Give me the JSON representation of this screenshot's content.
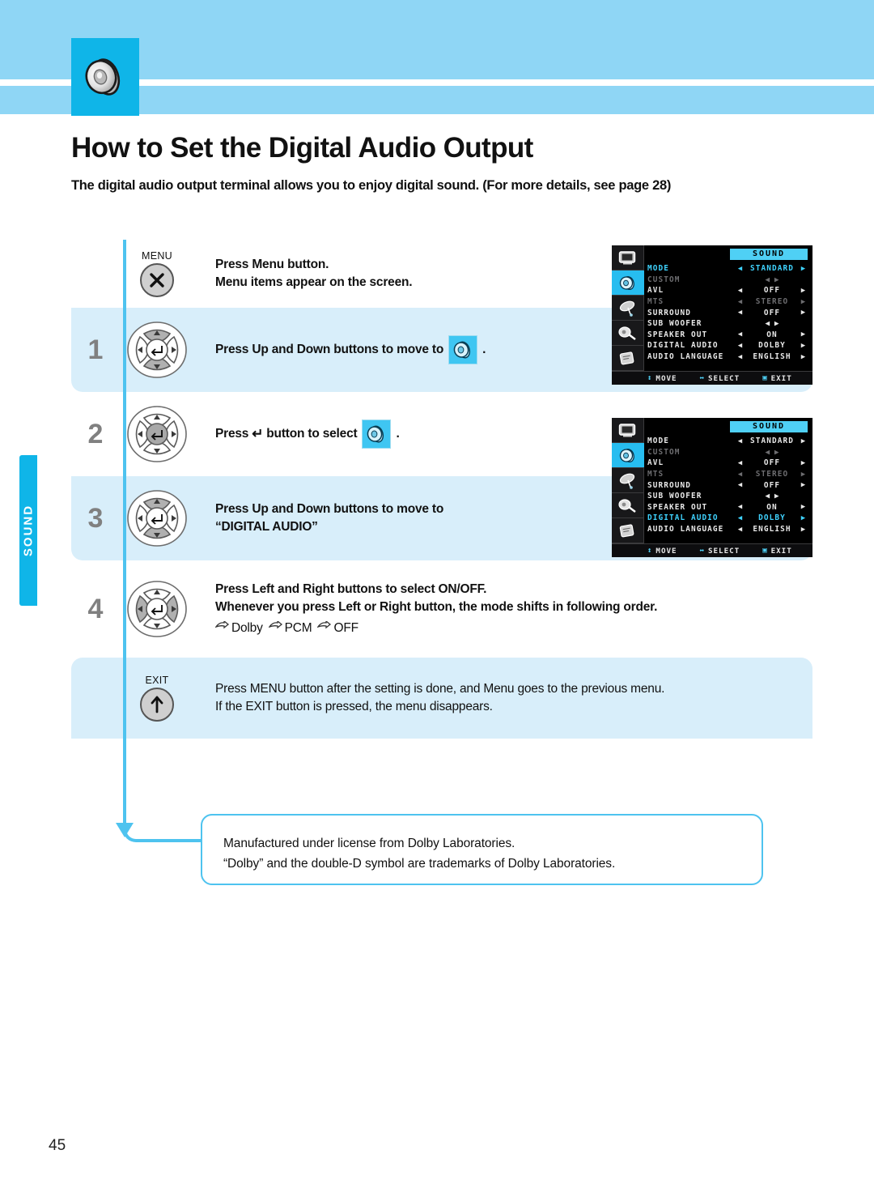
{
  "header": {
    "icon": "speaker-icon",
    "accent_color": "#0fb5e8",
    "band_color": "#8fd6f5"
  },
  "side_tab": {
    "label": "SOUND"
  },
  "title": "How to Set the Digital Audio Output",
  "subtitle": "The digital audio output terminal allows you to enjoy digital sound. (For more details, see page 28)",
  "steps": [
    {
      "number": "",
      "button": "menu-button",
      "button_label": "MENU",
      "lines": [
        "Press Menu button.",
        "Menu items appear on the screen."
      ],
      "tinted": false
    },
    {
      "number": "1",
      "button": "dpad-updown",
      "lines": [
        "Press Up and Down buttons to move to"
      ],
      "trailing": ".",
      "badge": "speaker-icon",
      "tinted": true
    },
    {
      "number": "2",
      "button": "dpad-enter",
      "lines": [
        "Press"
      ],
      "mid": "button to select",
      "trailing": ".",
      "badge": "speaker-icon",
      "enter_glyph": "↵",
      "tinted": false
    },
    {
      "number": "3",
      "button": "dpad-updown",
      "lines": [
        "Press Up and Down buttons to move to",
        "“DIGITAL AUDIO”"
      ],
      "tinted": true
    },
    {
      "number": "4",
      "button": "dpad-leftright",
      "lines": [
        "Press Left and Right buttons to select ON/OFF.",
        "Whenever you press Left or Right button, the mode shifts in following order."
      ],
      "order": [
        "Dolby",
        "PCM",
        "OFF"
      ],
      "tinted": false
    },
    {
      "number": "",
      "button": "exit-button",
      "button_label": "EXIT",
      "lines": [
        "Press MENU button after the setting is done, and Menu goes to the previous menu.",
        "If the EXIT button is pressed, the menu disappears."
      ],
      "light": true,
      "tinted": true
    }
  ],
  "osd": {
    "title": "SOUND",
    "side_icons": [
      "picture-icon",
      "speaker-icon",
      "satellite-icon",
      "tools-icon",
      "setup-icon"
    ],
    "selected_side_icon": 1,
    "status_bar": [
      {
        "glyph": "↕",
        "label": "MOVE"
      },
      {
        "glyph": "↔",
        "label": "SELECT"
      },
      {
        "glyph": "▣",
        "label": "EXIT"
      }
    ],
    "menu_1": {
      "rows": [
        {
          "label": "MODE",
          "value": "STANDARD",
          "state": "highlight",
          "arrows": "both"
        },
        {
          "label": "CUSTOM",
          "value": "",
          "state": "dim",
          "arrows": "pair"
        },
        {
          "label": "AVL",
          "value": "OFF",
          "state": "normal",
          "arrows": "both"
        },
        {
          "label": "MTS",
          "value": "STEREO",
          "state": "dim",
          "arrows": "both"
        },
        {
          "label": "SURROUND",
          "value": "OFF",
          "state": "normal",
          "arrows": "both"
        },
        {
          "label": "SUB WOOFER",
          "value": "",
          "state": "normal",
          "arrows": "pair"
        },
        {
          "label": "SPEAKER OUT",
          "value": "ON",
          "state": "normal",
          "arrows": "both"
        },
        {
          "label": "DIGITAL AUDIO",
          "value": "DOLBY",
          "state": "normal",
          "arrows": "both"
        },
        {
          "label": "AUDIO LANGUAGE",
          "value": "ENGLISH",
          "state": "normal",
          "arrows": "both"
        }
      ]
    },
    "menu_2": {
      "rows": [
        {
          "label": "MODE",
          "value": "STANDARD",
          "state": "normal",
          "arrows": "both"
        },
        {
          "label": "CUSTOM",
          "value": "",
          "state": "dim",
          "arrows": "pair"
        },
        {
          "label": "AVL",
          "value": "OFF",
          "state": "normal",
          "arrows": "both"
        },
        {
          "label": "MTS",
          "value": "STEREO",
          "state": "dim",
          "arrows": "both"
        },
        {
          "label": "SURROUND",
          "value": "OFF",
          "state": "normal",
          "arrows": "both"
        },
        {
          "label": "SUB WOOFER",
          "value": "",
          "state": "normal",
          "arrows": "pair"
        },
        {
          "label": "SPEAKER OUT",
          "value": "ON",
          "state": "normal",
          "arrows": "both"
        },
        {
          "label": "DIGITAL AUDIO",
          "value": "DOLBY",
          "state": "highlight",
          "arrows": "both"
        },
        {
          "label": "AUDIO LANGUAGE",
          "value": "ENGLISH",
          "state": "normal",
          "arrows": "both"
        }
      ]
    }
  },
  "note": {
    "line1": "Manufactured under license from Dolby Laboratories.",
    "line2": "“Dolby” and the double-D symbol are trademarks of Dolby Laboratories."
  },
  "page_number": "45"
}
